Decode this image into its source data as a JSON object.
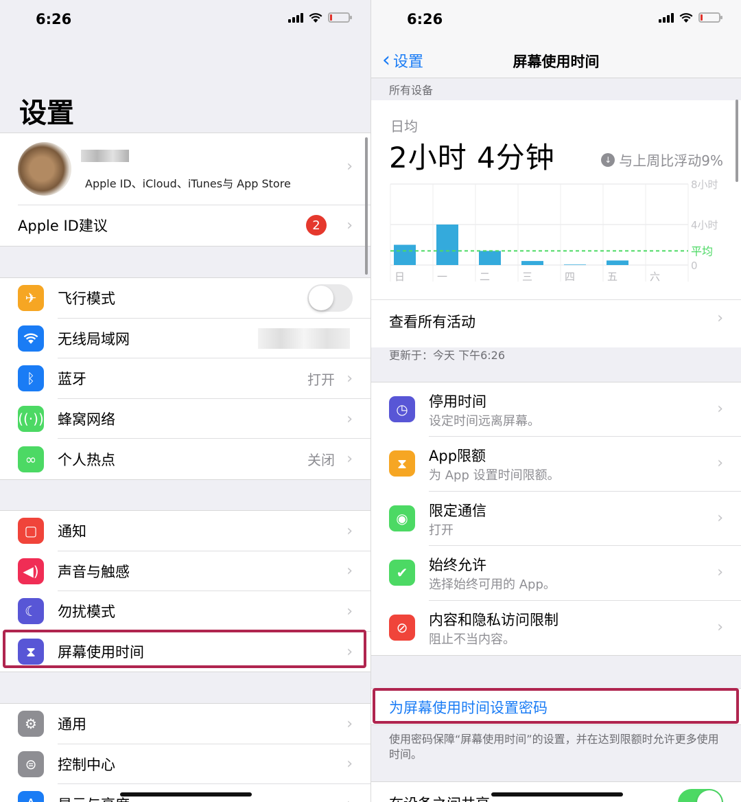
{
  "status_bar": {
    "time": "6:26"
  },
  "left": {
    "title": "设置",
    "profile": {
      "subtitle": "Apple ID、iCloud、iTunes与 App Store"
    },
    "apple_id_suggest": {
      "label": "Apple ID建议",
      "badge": "2"
    },
    "group1": [
      {
        "label": "飞行模式",
        "icon": "airplane-icon",
        "color": "#f6a623"
      },
      {
        "label": "无线局域网",
        "icon": "wifi-icon",
        "color": "#1a7cf5"
      },
      {
        "label": "蓝牙",
        "value": "打开",
        "icon": "bluetooth-icon",
        "color": "#1a7cf5"
      },
      {
        "label": "蜂窝网络",
        "icon": "antenna-icon",
        "color": "#4cd964"
      },
      {
        "label": "个人热点",
        "value": "关闭",
        "icon": "hotspot-icon",
        "color": "#4cd964"
      }
    ],
    "group2": [
      {
        "label": "通知",
        "icon": "notification-icon",
        "color": "#f0443a"
      },
      {
        "label": "声音与触感",
        "icon": "speaker-icon",
        "color": "#f02d55"
      },
      {
        "label": "勿扰模式",
        "icon": "moon-icon",
        "color": "#5856d6"
      },
      {
        "label": "屏幕使用时间",
        "icon": "hourglass-icon",
        "color": "#5856d6"
      }
    ],
    "group3": [
      {
        "label": "通用",
        "icon": "gear-icon",
        "color": "#8e8e93"
      },
      {
        "label": "控制中心",
        "icon": "toggles-icon",
        "color": "#8e8e93"
      },
      {
        "label": "显示与亮度",
        "icon": "display-icon",
        "color": "#1a7cf5"
      }
    ]
  },
  "right": {
    "back_label": "设置",
    "title": "屏幕使用时间",
    "section_header": "所有设备",
    "daily_avg_label": "日均",
    "daily_avg_value": "2小时 4分钟",
    "trend_text": "与上周比浮动9%",
    "view_all": "查看所有活动",
    "updated": "更新于：今天 下午6:26",
    "items": [
      {
        "title": "停用时间",
        "subtitle": "设定时间远离屏幕。",
        "icon": "downtime-icon",
        "color": "#5856d6"
      },
      {
        "title": "App限额",
        "subtitle": "为 App 设置时间限额。",
        "icon": "hourglass-icon",
        "color": "#f6a623"
      },
      {
        "title": "限定通信",
        "subtitle": "打开",
        "icon": "contact-icon",
        "color": "#4cd964"
      },
      {
        "title": "始终允许",
        "subtitle": "选择始终可用的 App。",
        "icon": "checkmark-icon",
        "color": "#4cd964"
      },
      {
        "title": "内容和隐私访问限制",
        "subtitle": "阻止不当内容。",
        "icon": "restrict-icon",
        "color": "#f0443a"
      }
    ],
    "passcode_label": "为屏幕使用时间设置密码",
    "passcode_note": "使用密码保障“屏幕使用时间”的设置，并在达到限额时允许更多使用时间。",
    "share_label": "在设备之间共享"
  },
  "chart_data": {
    "type": "bar",
    "categories": [
      "日",
      "一",
      "二",
      "三",
      "四",
      "五",
      "六"
    ],
    "values": [
      2.0,
      4.0,
      1.4,
      0.4,
      0.05,
      0.45,
      0
    ],
    "ylim": [
      0,
      8
    ],
    "y_ticks": [
      "8小时",
      "4小时",
      "0"
    ],
    "average": 1.4,
    "average_label": "平均",
    "bar_color": "#34aadc",
    "average_color": "#4cd964"
  },
  "highlight_color": "#b0254f"
}
